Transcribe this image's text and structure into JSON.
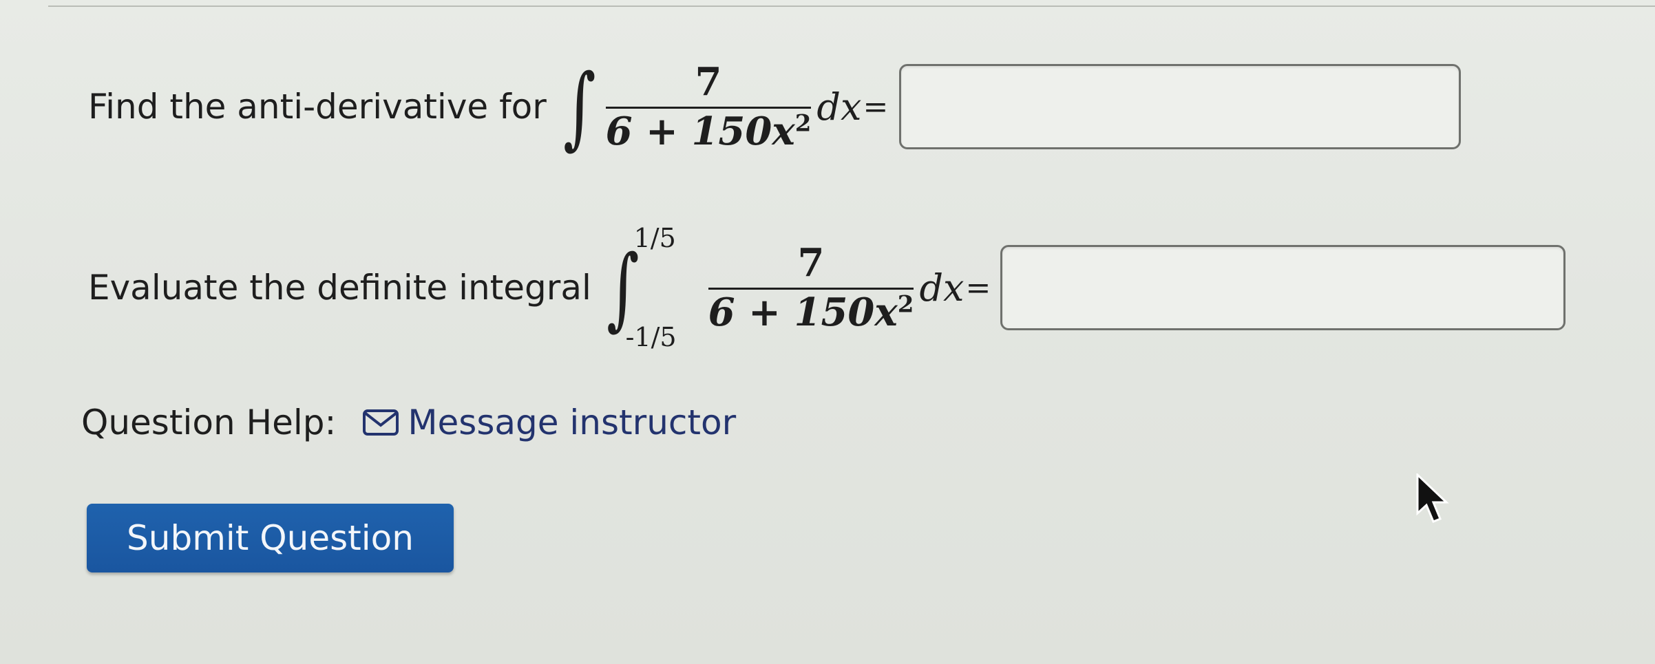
{
  "question1": {
    "prompt": "Find the anti-derivative for",
    "integral_sign": "∫",
    "numerator": "7",
    "denominator_base": "6 + 150x",
    "denominator_exp": "2",
    "dx": "dx",
    "equals": "="
  },
  "question2": {
    "prompt": "Evaluate the definite integral",
    "integral_sign": "∫",
    "upper_limit": "1/5",
    "lower_limit": "-1/5",
    "numerator": "7",
    "denominator_base": "6 + 150x",
    "denominator_exp": "2",
    "dx": "dx",
    "equals": "="
  },
  "help": {
    "label": "Question Help:",
    "icon": "mail-icon",
    "link": "Message instructor"
  },
  "submit": {
    "label": "Submit Question"
  },
  "colors": {
    "submit_bg": "#1f62ad",
    "link": "#23336e"
  }
}
